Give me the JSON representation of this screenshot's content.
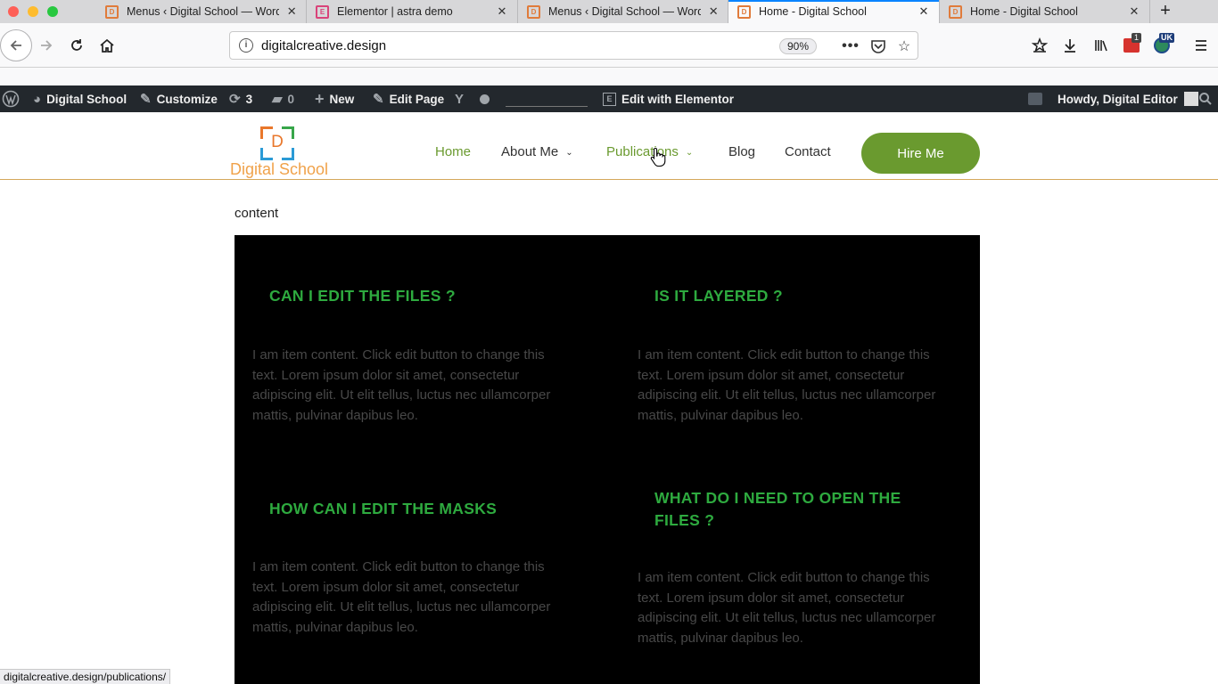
{
  "browser": {
    "tabs": [
      {
        "label": "Menus ‹ Digital School — WordPress",
        "type": "wp"
      },
      {
        "label": "Elementor | astra demo",
        "type": "elementor"
      },
      {
        "label": "Menus ‹ Digital School — WordPress",
        "type": "wp"
      },
      {
        "label": "Home - Digital School",
        "type": "ds",
        "active": true
      },
      {
        "label": "Home - Digital School",
        "type": "ds"
      }
    ],
    "url": "digitalcreative.design",
    "zoom": "90%",
    "badge_count": "1",
    "badge_uk": "UK",
    "status_url": "digitalcreative.design/publications/"
  },
  "adminbar": {
    "site_name": "Digital School",
    "customize": "Customize",
    "updates_count": "3",
    "comments_count": "0",
    "new_label": "New",
    "edit_page": "Edit Page",
    "edit_elementor": "Edit with Elementor",
    "howdy": "Howdy, Digital Editor"
  },
  "site": {
    "logo_letter": "D",
    "logo_text": "Digital School",
    "menu": {
      "home": "Home",
      "about": "About Me",
      "publications": "Publications",
      "blog": "Blog",
      "contact": "Contact"
    },
    "hire_button": "Hire Me"
  },
  "content": {
    "label": "content",
    "items": [
      {
        "title": "CAN I EDIT THE FILES ?",
        "body": "I am item content. Click edit button to change this text. Lorem ipsum dolor sit amet, consectetur adipiscing elit. Ut elit tellus, luctus nec ullamcorper mattis, pulvinar dapibus leo."
      },
      {
        "title": "IS IT LAYERED ?",
        "body": "I am item content. Click edit button to change this text. Lorem ipsum dolor sit amet, consectetur adipiscing elit. Ut elit tellus, luctus nec ullamcorper mattis, pulvinar dapibus leo."
      },
      {
        "title": "HOW CAN I EDIT THE MASKS",
        "body": "I am item content. Click edit button to change this text. Lorem ipsum dolor sit amet, consectetur adipiscing elit. Ut elit tellus, luctus nec ullamcorper mattis, pulvinar dapibus leo."
      },
      {
        "title": "WHAT DO I NEED TO OPEN THE FILES ?",
        "body": "I am item content. Click edit button to change this text. Lorem ipsum dolor sit amet, consectetur adipiscing elit. Ut elit tellus, luctus nec ullamcorper mattis, pulvinar dapibus leo."
      }
    ]
  },
  "colors": {
    "accent_green": "#6a9a2f",
    "heading_green": "#2eaa3f",
    "header_border": "#d4a85a",
    "adminbar_bg": "#23282d"
  }
}
